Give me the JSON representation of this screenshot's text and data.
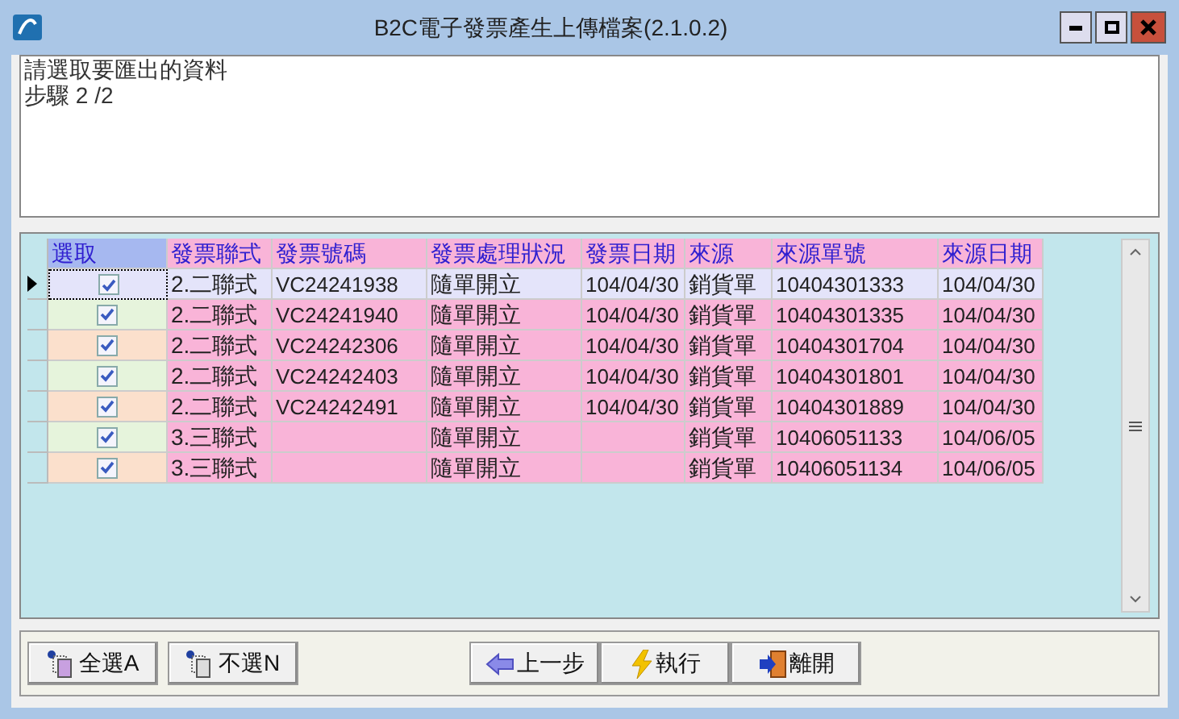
{
  "window": {
    "title": "B2C電子發票產生上傳檔案(2.1.0.2)"
  },
  "message": [
    "請選取要匯出的資料",
    "步驟 2 /2"
  ],
  "table": {
    "columns": [
      "選取",
      "發票聯式",
      "發票號碼",
      "發票處理狀況",
      "發票日期",
      "來源",
      "來源單號",
      "來源日期"
    ],
    "rows": [
      {
        "current": true,
        "checked": true,
        "cells": [
          "",
          "2.二聯式",
          "VC24241938",
          "隨單開立",
          "104/04/30",
          "銷貨單",
          "10404301333",
          "104/04/30"
        ]
      },
      {
        "current": false,
        "checked": true,
        "cells": [
          "",
          "2.二聯式",
          "VC24241940",
          "隨單開立",
          "104/04/30",
          "銷貨單",
          "10404301335",
          "104/04/30"
        ]
      },
      {
        "current": false,
        "checked": true,
        "cells": [
          "",
          "2.二聯式",
          "VC24242306",
          "隨單開立",
          "104/04/30",
          "銷貨單",
          "10404301704",
          "104/04/30"
        ]
      },
      {
        "current": false,
        "checked": true,
        "cells": [
          "",
          "2.二聯式",
          "VC24242403",
          "隨單開立",
          "104/04/30",
          "銷貨單",
          "10404301801",
          "104/04/30"
        ]
      },
      {
        "current": false,
        "checked": true,
        "cells": [
          "",
          "2.二聯式",
          "VC24242491",
          "隨單開立",
          "104/04/30",
          "銷貨單",
          "10404301889",
          "104/04/30"
        ]
      },
      {
        "current": false,
        "checked": true,
        "cells": [
          "",
          "3.三聯式",
          "",
          "隨單開立",
          "",
          "銷貨單",
          "10406051133",
          "104/06/05"
        ]
      },
      {
        "current": false,
        "checked": true,
        "cells": [
          "",
          "3.三聯式",
          "",
          "隨單開立",
          "",
          "銷貨單",
          "10406051134",
          "104/06/05"
        ]
      }
    ]
  },
  "buttons": [
    {
      "kind": "select_all",
      "label": "全選A"
    },
    {
      "kind": "select_none",
      "label": "不選N"
    },
    {
      "kind": "back",
      "label": "上一步"
    },
    {
      "kind": "run",
      "label": "執行"
    },
    {
      "kind": "exit",
      "label": "離開"
    }
  ]
}
